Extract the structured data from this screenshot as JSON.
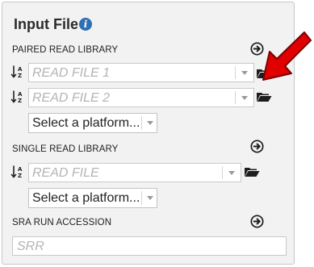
{
  "panel": {
    "title": "Input File",
    "info_icon": "info-icon"
  },
  "paired": {
    "label": "PAIRED READ LIBRARY",
    "read1_placeholder": "READ FILE 1",
    "read2_placeholder": "READ FILE 2",
    "platform_value": "Select a platform..."
  },
  "single": {
    "label": "SINGLE READ LIBRARY",
    "read_placeholder": "READ FILE",
    "platform_value": "Select a platform..."
  },
  "sra": {
    "label": "SRA RUN ACCESSION",
    "placeholder": "SRR"
  },
  "icons": {
    "add": "circle-arrow-right-icon",
    "sort": "sort-alpha-down-icon",
    "folder": "folder-open-icon",
    "pointer": "red-arrow-icon"
  },
  "colors": {
    "panel_bg": "#f2f2f2",
    "info_blue": "#2e6fb3",
    "pointer_red": "#e10000",
    "placeholder": "#b4b4b4"
  }
}
